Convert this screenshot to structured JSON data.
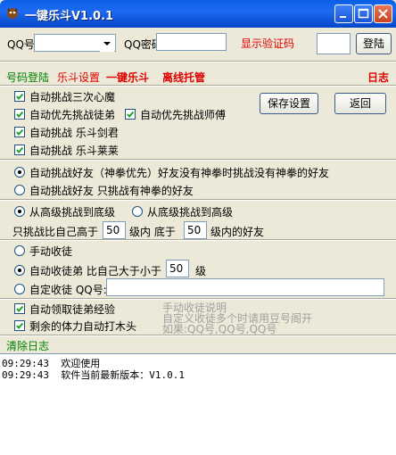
{
  "window": {
    "title": "一键乐斗V1.0.1"
  },
  "login": {
    "qq_label": "QQ号",
    "qq_value": "",
    "password_label": "QQ密码",
    "password_value": "",
    "captcha_link": "显示验证码",
    "captcha_value": "",
    "login_button": "登陆"
  },
  "tabs": {
    "account_login": "号码登陆",
    "fight_settings": "乐斗设置",
    "one_click": "一键乐斗",
    "offline_hosting": "离线托管",
    "log": "日志"
  },
  "options": {
    "challenge_demon": {
      "label": "自动挑战三次心魔",
      "checked": true
    },
    "challenge_disciple": {
      "label": "自动优先挑战徒弟",
      "checked": true
    },
    "challenge_master": {
      "label": "自动优先挑战师傅",
      "checked": true
    },
    "challenge_sword": {
      "label": "自动挑战  乐斗剑君",
      "checked": true
    },
    "challenge_lailai": {
      "label": "自动挑战  乐斗莱莱",
      "checked": true
    },
    "friend_mode_1": {
      "label": "自动挑战好友（神拳优先）好友没有神拳时挑战没有神拳的好友",
      "selected": true
    },
    "friend_mode_2": {
      "label": "自动挑战好友 只挑战有神拳的好友",
      "selected": false
    },
    "order_high_low": {
      "label": "从高级挑战到底级",
      "selected": true
    },
    "order_low_high": {
      "label": "从底级挑战到高级",
      "selected": false
    },
    "level_prefix": "只挑战比自己高于",
    "level_high_value": "50",
    "level_middle": "级内  底于",
    "level_low_value": "50",
    "level_suffix": "级内的好友",
    "manual_collect": {
      "label": "手动收徒",
      "selected": false
    },
    "auto_collect": {
      "label": "自动收徒弟  比自己大于小于",
      "selected": true
    },
    "auto_collect_value": "50",
    "auto_collect_suffix": "级",
    "custom_collect": {
      "label": "自定收徒  QQ号:",
      "selected": false
    },
    "custom_collect_value": "",
    "claim_exp": {
      "label": "自动领取徒弟经验",
      "checked": true
    },
    "auto_wood": {
      "label": "剩余的体力自动打木头",
      "checked": true
    },
    "hint_lines": [
      "手动收徒说明",
      "自定义收徒多个时请用豆号阁开",
      "如果:QQ号,QQ号,QQ号"
    ],
    "save_button": "保存设置",
    "back_button": "返回"
  },
  "log": {
    "clear_label": "清除日志",
    "lines": [
      "09:29:43  欢迎使用",
      "09:29:43  软件当前最新版本：V1.0.1"
    ]
  }
}
